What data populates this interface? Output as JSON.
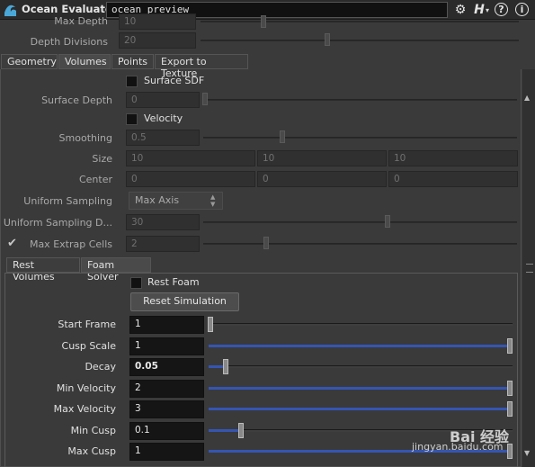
{
  "header": {
    "node_type": "Ocean Evaluate",
    "node_name": "ocean_preview",
    "help_label": "H",
    "question_label": "?",
    "info_label": "i"
  },
  "params_top": {
    "max_depth_label": "Max Depth",
    "max_depth_value": "10",
    "depth_div_label": "Depth Divisions",
    "depth_div_value": "20"
  },
  "tabs": {
    "geometry": "Geometry",
    "volumes": "Volumes",
    "points": "Points",
    "export": "Export to Texture"
  },
  "volumes": {
    "surface_sdf_label": "Surface SDF",
    "surface_depth_label": "Surface Depth",
    "surface_depth_value": "0",
    "velocity_label": "Velocity",
    "smoothing_label": "Smoothing",
    "smoothing_value": "0.5",
    "size_label": "Size",
    "size_values": [
      "10",
      "10",
      "10"
    ],
    "center_label": "Center",
    "center_values": [
      "0",
      "0",
      "0"
    ],
    "uniform_sampling_label": "Uniform Sampling",
    "uniform_sampling_value": "Max Axis",
    "uniform_sampling_div_label": "Uniform Sampling D...",
    "uniform_sampling_div_value": "30",
    "max_extrap_label": "Max Extrap Cells",
    "max_extrap_value": "2"
  },
  "subtabs": {
    "rest_volumes": "Rest Volumes",
    "foam_solver": "Foam Solver"
  },
  "foam": {
    "rest_foam_label": "Rest Foam",
    "reset_sim_label": "Reset Simulation",
    "rows": [
      {
        "label": "Start Frame",
        "value": "1",
        "fill": 0.0
      },
      {
        "label": "Cusp Scale",
        "value": "1",
        "fill": 1.0
      },
      {
        "label": "Decay",
        "value": "0.05",
        "fill": 0.05
      },
      {
        "label": "Min Velocity",
        "value": "2",
        "fill": 1.0
      },
      {
        "label": "Max Velocity",
        "value": "3",
        "fill": 1.0
      },
      {
        "label": "Min Cusp",
        "value": "0.1",
        "fill": 0.1
      },
      {
        "label": "Max Cusp",
        "value": "1",
        "fill": 1.0
      }
    ]
  },
  "watermark": {
    "brand": "Bai 经验",
    "url": "jingyan.baidu.com"
  },
  "colors": {
    "accent": "#3555b2",
    "background": "#3a3a3a"
  }
}
